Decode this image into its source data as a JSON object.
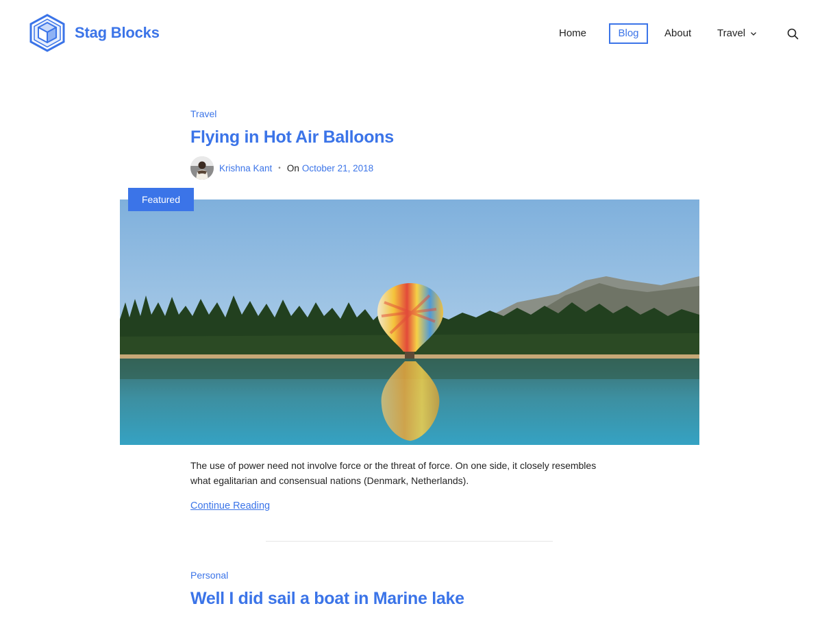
{
  "site": {
    "name": "Stag Blocks",
    "logo_icon": "cube-logo-icon"
  },
  "nav": {
    "items": [
      {
        "label": "Home",
        "active": false
      },
      {
        "label": "Blog",
        "active": true
      },
      {
        "label": "About",
        "active": false
      },
      {
        "label": "Travel",
        "active": false,
        "has_dropdown": true
      }
    ],
    "search_icon": "search-icon"
  },
  "posts": [
    {
      "category": "Travel",
      "title": "Flying in Hot Air Balloons",
      "author": "Krishna Kant",
      "date_prefix": "On",
      "date": "October 21, 2018",
      "badge": "Featured",
      "excerpt": "The use of power need not involve force or the threat of force. On one side, it closely resembles what egalitarian and consensual nations (Denmark, Netherlands).",
      "read_more": "Continue Reading"
    },
    {
      "category": "Personal",
      "title": "Well I did sail a boat in Marine lake"
    }
  ],
  "colors": {
    "accent": "#3b74e8",
    "text": "#222222",
    "divider": "#e5e5e5"
  }
}
